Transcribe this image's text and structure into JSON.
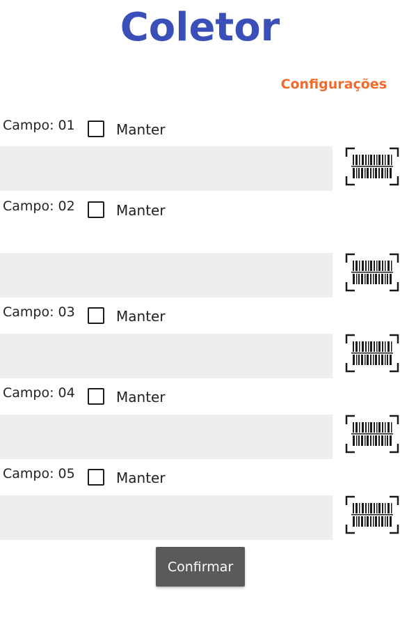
{
  "app": {
    "title": "Coletor",
    "settings_label": "Configurações"
  },
  "fields": [
    {
      "label": "Campo: 01",
      "keep_label": "Manter",
      "keep_checked": false,
      "value": ""
    },
    {
      "label": "Campo: 02",
      "keep_label": "Manter",
      "keep_checked": false,
      "value": ""
    },
    {
      "label": "Campo: 03",
      "keep_label": "Manter",
      "keep_checked": false,
      "value": ""
    },
    {
      "label": "Campo: 04",
      "keep_label": "Manter",
      "keep_checked": false,
      "value": ""
    },
    {
      "label": "Campo: 05",
      "keep_label": "Manter",
      "keep_checked": false,
      "value": ""
    }
  ],
  "confirm_label": "Confirmar",
  "icons": {
    "scan": "barcode-scan-icon"
  },
  "colors": {
    "title": "#3b4fb8",
    "settings": "#f26a2a",
    "input_bg": "#eeeeee",
    "button_bg": "#5a5a5a"
  }
}
